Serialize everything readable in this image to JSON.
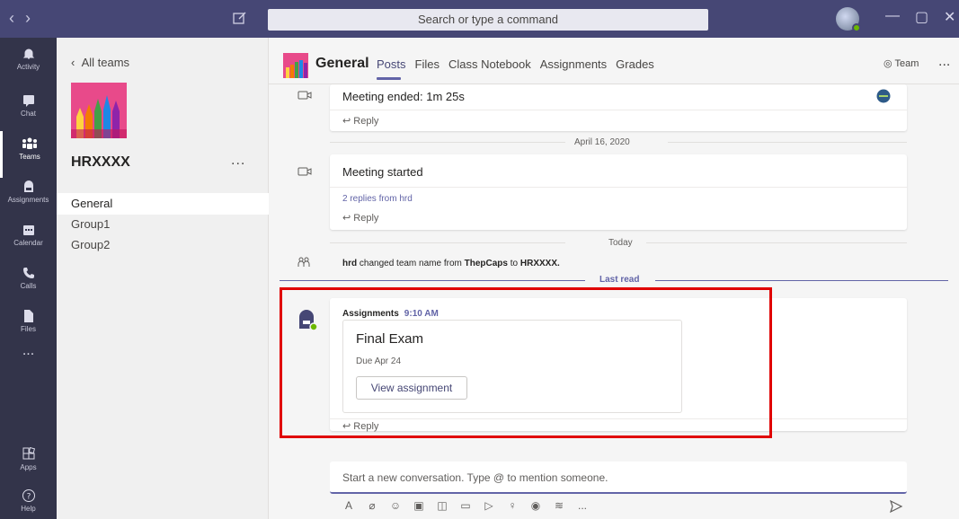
{
  "titlebar": {
    "search_placeholder": "Search or type a command",
    "nav_back": "‹",
    "nav_forward": "›",
    "minimize": "—",
    "maximize": "▢",
    "close": "✕"
  },
  "rail": {
    "items": [
      {
        "label": "Activity",
        "icon": "bell-icon"
      },
      {
        "label": "Chat",
        "icon": "chat-icon"
      },
      {
        "label": "Teams",
        "icon": "teams-icon"
      },
      {
        "label": "Assignments",
        "icon": "backpack-icon"
      },
      {
        "label": "Calendar",
        "icon": "calendar-icon"
      },
      {
        "label": "Calls",
        "icon": "phone-icon"
      },
      {
        "label": "Files",
        "icon": "file-icon"
      },
      {
        "label": "...",
        "icon": "more-icon"
      }
    ],
    "apps_label": "Apps",
    "help_label": "Help",
    "active": "Teams"
  },
  "teampanel": {
    "back_label": "All teams",
    "team_name": "HRXXXX",
    "more": "...",
    "channels": [
      "General",
      "Group1",
      "Group2"
    ],
    "active_channel": "General"
  },
  "header": {
    "channel": "General",
    "tabs": [
      "Posts",
      "Files",
      "Class Notebook",
      "Assignments",
      "Grades"
    ],
    "active_tab": "Posts",
    "team_button": "Team",
    "more": "..."
  },
  "feed": {
    "meeting_ended": "Meeting ended: 1m 25s",
    "reply": "Reply",
    "date1": "April 16, 2020",
    "meeting_started": "Meeting started",
    "replies_from": "2 replies from hrd",
    "date2": "Today",
    "sys_user": "hrd",
    "sys_text_1": " changed team name from ",
    "sys_old": "ThepCaps",
    "sys_text_2": " to ",
    "sys_new": "HRXXXX.",
    "last_read": "Last read",
    "assignment": {
      "from": "Assignments",
      "time": "9:10 AM",
      "title": "Final Exam",
      "due": "Due Apr 24",
      "button": "View assignment"
    }
  },
  "compose": {
    "placeholder": "Start a new conversation. Type @ to mention someone.",
    "toolbar_more": "..."
  },
  "colors": {
    "brand": "#464775",
    "accent": "#6264a7",
    "rail": "#33344a",
    "highlight": "#e00000"
  }
}
